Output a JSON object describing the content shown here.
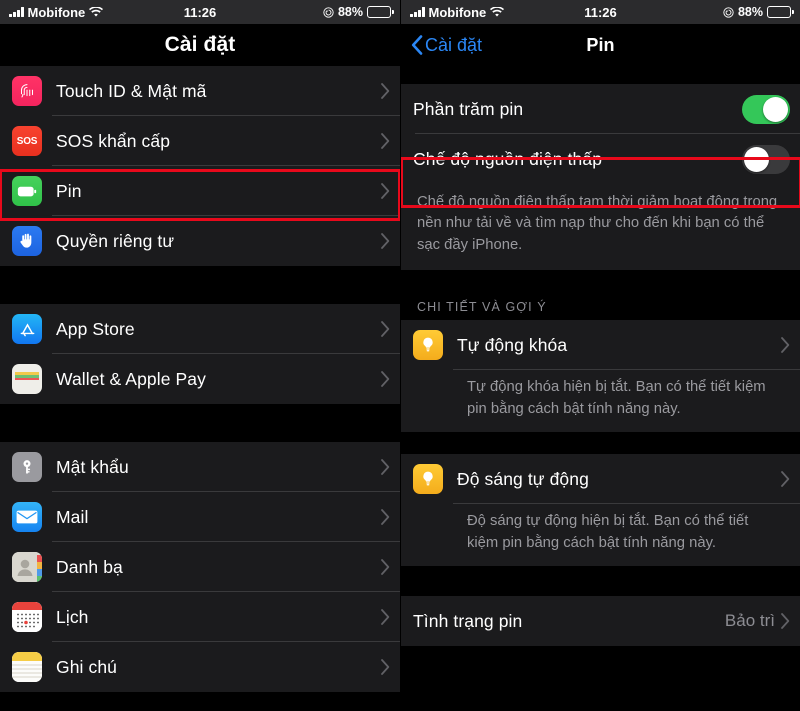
{
  "status_bar": {
    "carrier": "Mobifone",
    "time": "11:26",
    "battery_percent": "88%",
    "signal_icon": "signal-bars-icon",
    "wifi_icon": "wifi-icon",
    "orientation_lock_icon": "rotation-lock-icon",
    "battery_icon": "battery-icon"
  },
  "left_screen": {
    "nav": {
      "title": "Cài đặt"
    },
    "groups": [
      {
        "rows": [
          {
            "label": "Touch ID & Mật mã",
            "icon": "fingerprint-icon",
            "chevron": true
          },
          {
            "label": "SOS khẩn cấp",
            "icon": "sos-icon",
            "chevron": true
          },
          {
            "label": "Pin",
            "icon": "battery-icon",
            "chevron": true,
            "highlighted": true
          },
          {
            "label": "Quyền riêng tư",
            "icon": "hand-privacy-icon",
            "chevron": true
          }
        ]
      },
      {
        "rows": [
          {
            "label": "App Store",
            "icon": "app-store-icon",
            "chevron": true
          },
          {
            "label": "Wallet & Apple Pay",
            "icon": "wallet-icon",
            "chevron": true
          }
        ]
      },
      {
        "rows": [
          {
            "label": "Mật khẩu",
            "icon": "key-icon",
            "chevron": true
          },
          {
            "label": "Mail",
            "icon": "mail-icon",
            "chevron": true
          },
          {
            "label": "Danh bạ",
            "icon": "contacts-icon",
            "chevron": true
          },
          {
            "label": "Lịch",
            "icon": "calendar-icon",
            "chevron": true
          },
          {
            "label": "Ghi chú",
            "icon": "notes-icon",
            "chevron": true
          }
        ]
      }
    ]
  },
  "right_screen": {
    "nav": {
      "back_label": "Cài đặt",
      "title": "Pin",
      "back_icon": "chevron-left-icon"
    },
    "battery_percent_row": {
      "label": "Phần trăm pin",
      "toggle_state": "on"
    },
    "low_power_row": {
      "label": "Chế độ nguồn điện thấp",
      "toggle_state": "off",
      "highlighted": true
    },
    "low_power_description": "Chế độ nguồn điện thấp tạm thời giảm hoạt động trong nền như tải về và tìm nạp thư cho đến khi bạn có thể sạc đầy iPhone.",
    "section_header": "CHI TIẾT VÀ GỢI Ý",
    "suggestions": [
      {
        "label": "Tự động khóa",
        "icon": "lightbulb-icon",
        "chevron": true,
        "description": "Tự động khóa hiện bị tắt. Bạn có thể tiết kiệm pin bằng cách bật tính năng này."
      },
      {
        "label": "Độ sáng tự động",
        "icon": "lightbulb-icon",
        "chevron": true,
        "description": "Độ sáng tự động hiện bị tắt. Bạn có thể tiết kiệm pin bằng cách bật tính năng này."
      }
    ],
    "battery_health_row": {
      "label": "Tình trạng pin",
      "value": "Bảo trì",
      "chevron": true
    }
  },
  "colors": {
    "accent_blue": "#2b87f5",
    "toggle_on": "#34c759",
    "toggle_off": "#3a3a3c",
    "highlight_red": "#e8091b",
    "row_background": "#1b1b1d",
    "page_background": "#000000",
    "secondary_text": "#9a9a9f"
  }
}
